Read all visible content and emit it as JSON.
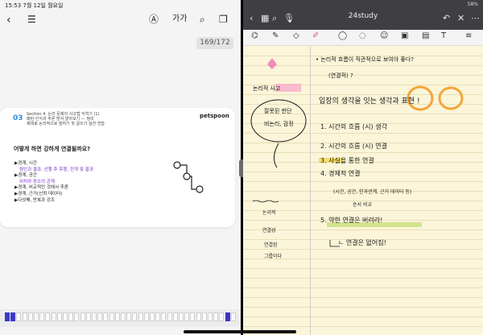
{
  "left_pane": {
    "status_time": "15:53  7월 12일 월요일",
    "page_count": "169/172",
    "font_toggle": "가가",
    "lesson": {
      "number": "03",
      "lines": [
        "Section 4. 논리 문제의 사고법 익히기 (1)",
        "패턴 인식과 추론 방식 알아보기 — 정리",
        "제대로 논리적으로 말하기 및 글쓰기 실전 연습"
      ],
      "brand": "petspoon",
      "question": "어떻게 하면 강하게 연결될까요?",
      "bullets": [
        {
          "text": "▶경계, 시간",
          "kind": "main"
        },
        {
          "text": "원인과 결과, 선행 후 후행, 전개 및 결과",
          "kind": "sub"
        },
        {
          "text": "▶경계, 공간",
          "kind": "main"
        },
        {
          "text": "위치와 장소의 관계",
          "kind": "sub"
        },
        {
          "text": "▶경계, 비교적인 것에서 추론",
          "kind": "main"
        },
        {
          "text": "▶경계, 근거(신뢰 데이터)",
          "kind": "main"
        },
        {
          "text": "▶다섯째, 반복과 강조",
          "kind": "main"
        }
      ]
    },
    "icons": [
      "back-icon",
      "toc-icon",
      "accessibility-icon",
      "search-icon",
      "bookmark-icon"
    ]
  },
  "right_pane": {
    "status": "58%",
    "title": "24study",
    "icons": [
      "back-icon",
      "grid-icon",
      "search-icon",
      "mic-icon",
      "undo-icon",
      "close-icon",
      "more-icon"
    ],
    "handwriting": {
      "l1": "• 논리적 흐름이 직관적으로 보여야 좋다?",
      "l2": "(연결적) ?",
      "l3": "입장의 생각을 잇는 생각과 표현 !",
      "n1": "1. 시간의 흐름 (시) 생각",
      "n2": "2. 시간의 흐름 (시) 연결",
      "n3": "3. 사실을 통한 연결",
      "n4": "4. 경제적 연결",
      "n4a": "(시간, 공간, 인과관계, 근거 데이터 등)",
      "n4b": "순서  비교",
      "n5": "5. 약한 연결은 버려라!",
      "n6": "ㄴ 연결은 없어짐!",
      "m1": "논리적 사고",
      "m2": "잘못된 판단",
      "m3": "비논리, 감정",
      "m4": "논리적",
      "m5": "연결성",
      "m6": "연결된",
      "m7": "그룹이다"
    }
  },
  "colors": {
    "paper": "#fbf5d9",
    "pink_highlight": "#f7a8c9",
    "yellow_highlight": "#f4d94a",
    "orange_circle": "#f3a53a",
    "green_highlight": "#c9e07a",
    "purple_accent": "#7a2ecb"
  }
}
